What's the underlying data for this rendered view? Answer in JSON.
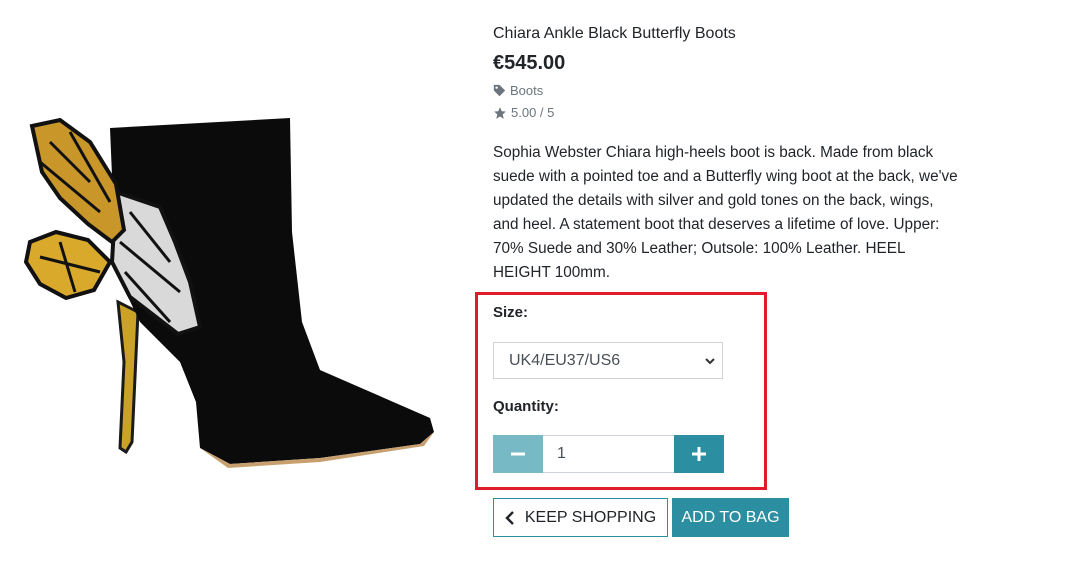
{
  "product": {
    "title": "Chiara Ankle Black Butterfly Boots",
    "price": "€545.00",
    "category": "Boots",
    "rating": "5.00 / 5",
    "description": "Sophia Webster Chiara high-heels boot is back. Made from black suede with a pointed toe and a Butterfly wing boot at the back, we've updated the details with silver and gold tones on the back, wings, and heel. A statement boot that deserves a lifetime of love. Upper: 70% Suede and 30% Leather; Outsole: 100% Leather. HEEL HEIGHT 100mm.",
    "image_icon": "black-butterfly-ankle-boot"
  },
  "options": {
    "size_label": "Size:",
    "size_value": "UK4/EU37/US6",
    "quantity_label": "Quantity:",
    "quantity_value": "1",
    "minus_icon": "minus-icon",
    "plus_icon": "plus-icon"
  },
  "actions": {
    "keep_shopping": "KEEP SHOPPING",
    "add_to_bag": "ADD TO BAG"
  },
  "colors": {
    "accent": "#2b8ea1",
    "accent_light": "#77b9c4",
    "highlight": "#e21b2a"
  }
}
